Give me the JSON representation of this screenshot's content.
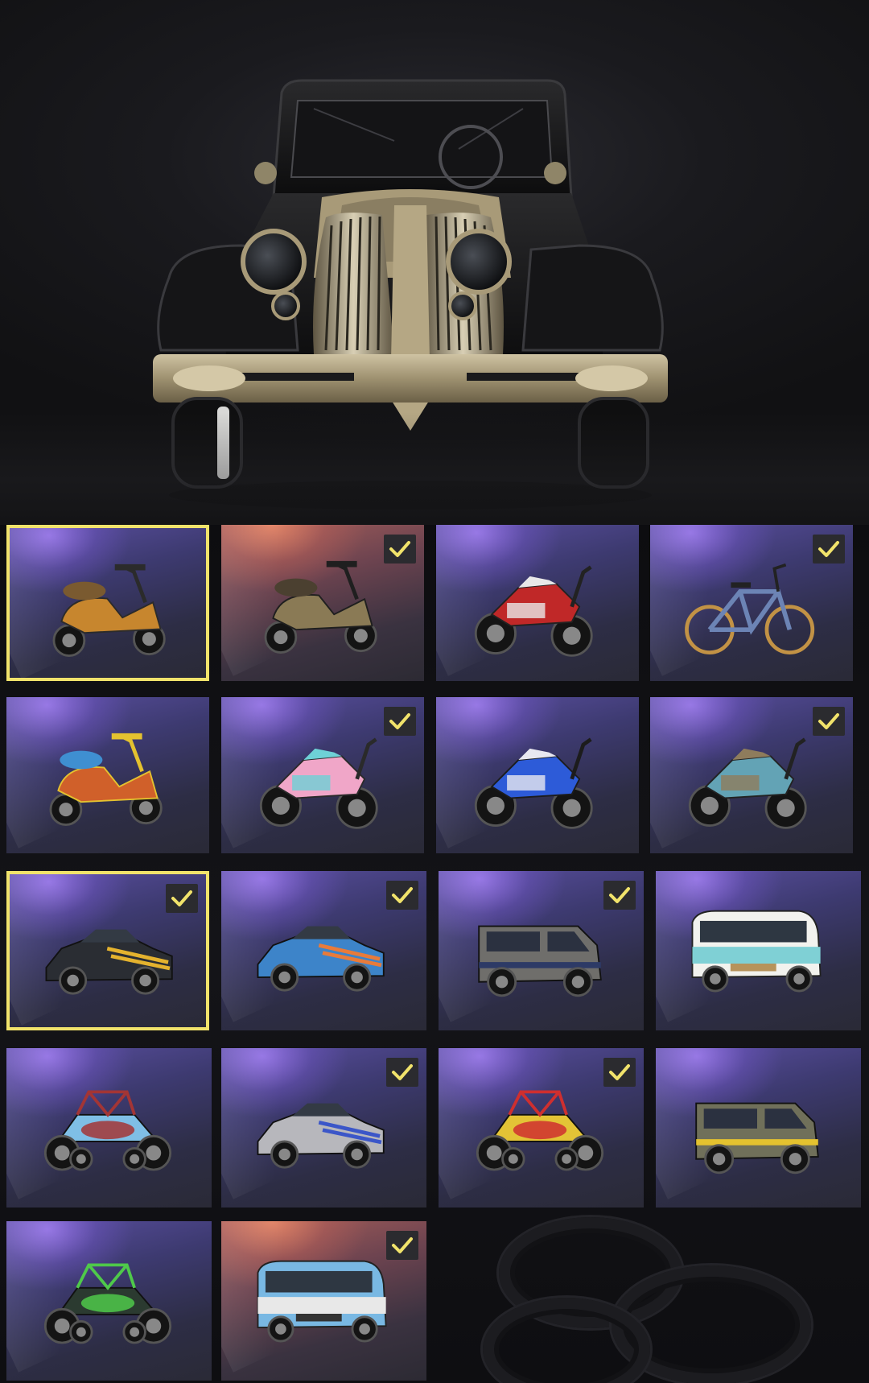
{
  "preview": {
    "vehicle": "vintage-sedan-icon"
  },
  "colors": {
    "selected_border": "#f1e36b",
    "epic_tile": "#3d3a70",
    "legendary_tile": "#a8605a",
    "checkmark": "#f1e36b"
  },
  "tiles": [
    {
      "vehicle": "scooter-icon",
      "rarity": "epic",
      "selected": true,
      "owned": false
    },
    {
      "vehicle": "scooter-icon",
      "rarity": "legendary",
      "selected": false,
      "owned": true
    },
    {
      "vehicle": "motorcycle-icon",
      "rarity": "epic",
      "selected": false,
      "owned": false
    },
    {
      "vehicle": "bicycle-icon",
      "rarity": "epic",
      "selected": false,
      "owned": true
    },
    {
      "vehicle": "scooter-icon",
      "rarity": "epic",
      "selected": false,
      "owned": false
    },
    {
      "vehicle": "motorcycle-icon",
      "rarity": "epic",
      "selected": false,
      "owned": true
    },
    {
      "vehicle": "motorcycle-icon",
      "rarity": "epic",
      "selected": false,
      "owned": false
    },
    {
      "vehicle": "dirt-bike-icon",
      "rarity": "epic",
      "selected": false,
      "owned": true
    },
    {
      "vehicle": "muscle-car-icon",
      "rarity": "epic",
      "selected": true,
      "owned": true
    },
    {
      "vehicle": "pickup-truck-icon",
      "rarity": "epic",
      "selected": false,
      "owned": true
    },
    {
      "vehicle": "suv-icon",
      "rarity": "epic",
      "selected": false,
      "owned": true
    },
    {
      "vehicle": "minibus-icon",
      "rarity": "epic",
      "selected": false,
      "owned": false
    },
    {
      "vehicle": "buggy-icon",
      "rarity": "epic",
      "selected": false,
      "owned": false
    },
    {
      "vehicle": "sedan-icon",
      "rarity": "epic",
      "selected": false,
      "owned": true
    },
    {
      "vehicle": "buggy-icon",
      "rarity": "epic",
      "selected": false,
      "owned": true
    },
    {
      "vehicle": "suv-icon",
      "rarity": "epic",
      "selected": false,
      "owned": false
    },
    {
      "vehicle": "buggy-icon",
      "rarity": "epic",
      "selected": false,
      "owned": false
    },
    {
      "vehicle": "minibus-icon",
      "rarity": "legendary",
      "selected": false,
      "owned": true
    }
  ]
}
